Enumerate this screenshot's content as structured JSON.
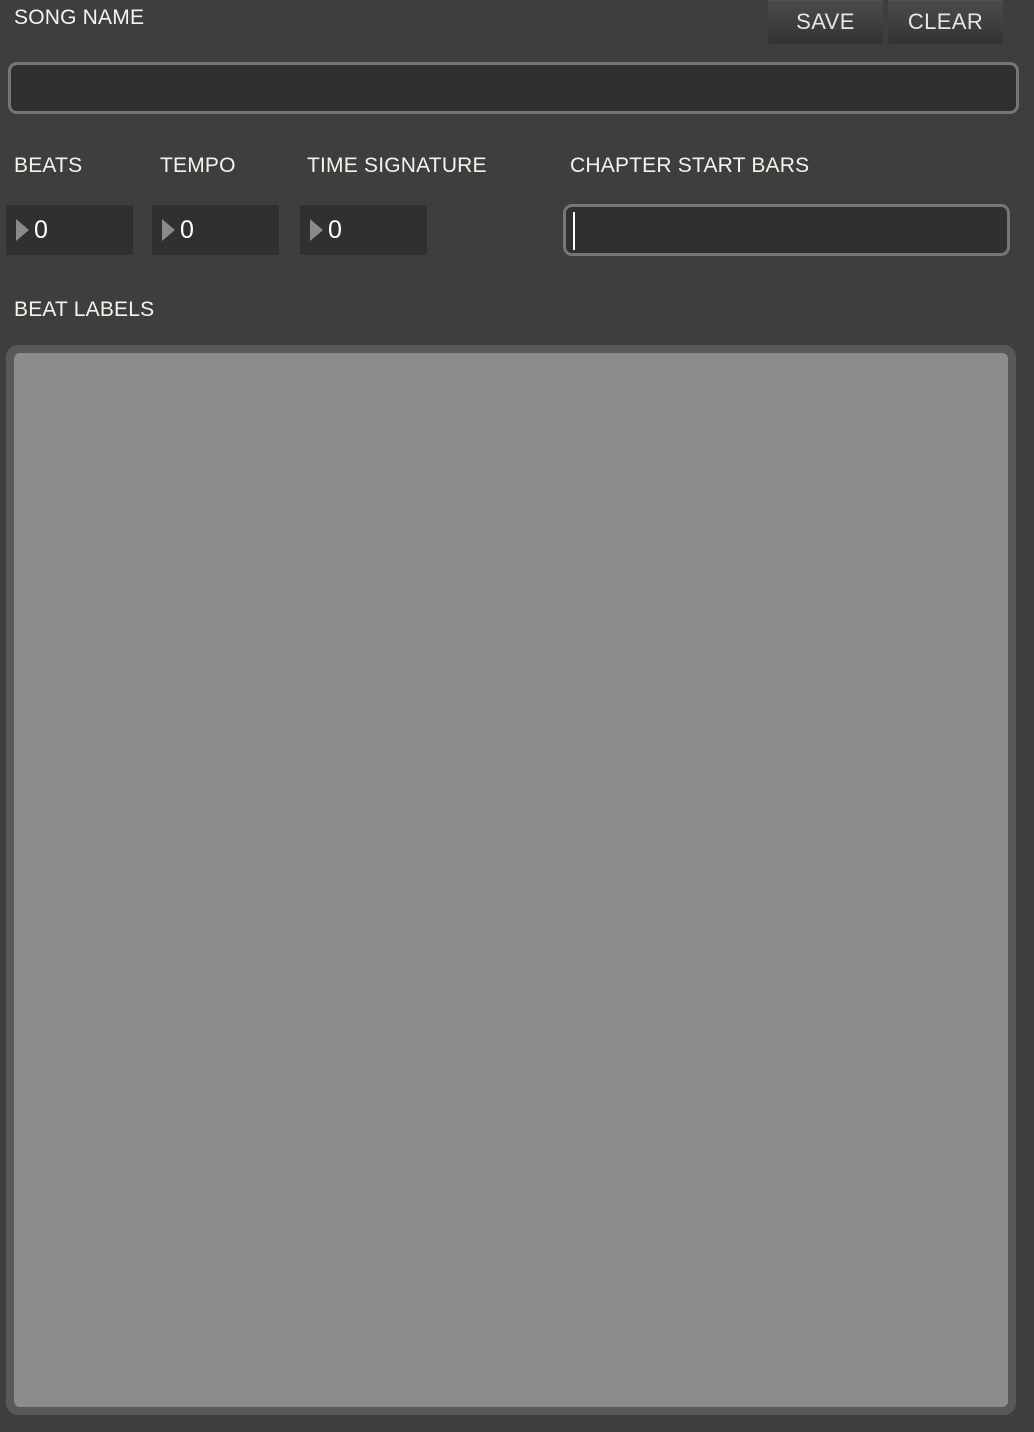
{
  "window": {
    "background_color": "#3e3e3e",
    "panel_color": "#3e3e3e"
  },
  "header": {
    "song_name_label": "SONG NAME",
    "save_label": "SAVE",
    "clear_label": "CLEAR"
  },
  "song_name": {
    "value": "",
    "placeholder": ""
  },
  "fields": {
    "beats": {
      "label": "BEATS",
      "value": "0",
      "arrow_icon": "triangle-right-icon"
    },
    "tempo": {
      "label": "TEMPO",
      "value": "0",
      "arrow_icon": "triangle-right-icon"
    },
    "time_signature": {
      "label": "TIME SIGNATURE",
      "value": "0",
      "arrow_icon": "triangle-right-icon"
    },
    "chapter_start_bars": {
      "label": "CHAPTER START BARS",
      "value": "",
      "placeholder": "",
      "focused": true
    }
  },
  "beat_labels": {
    "label": "BEAT LABELS",
    "items": [],
    "fill_color": "#8c8c8c",
    "frame_color": "#58585a"
  },
  "colors": {
    "text": "#f7f3eb",
    "input_bg": "#303030",
    "input_border": "#767676",
    "button_text": "#dfe7ea",
    "caret": "#ffffff",
    "arrow": "#8a8a8a"
  }
}
